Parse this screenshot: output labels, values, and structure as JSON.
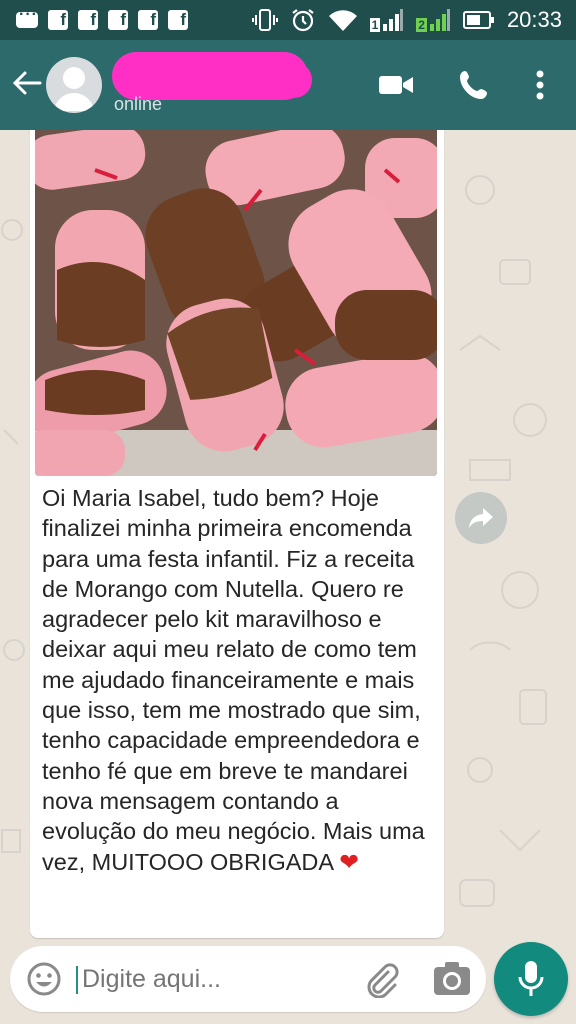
{
  "status_bar": {
    "time": "20:33",
    "sim2_label": "2",
    "sim1_label": "1",
    "icons": [
      "chat-icon",
      "facebook-icon",
      "facebook-icon",
      "facebook-icon",
      "facebook-icon",
      "facebook-icon",
      "vibrate-icon",
      "alarm-icon",
      "wifi-icon",
      "signal-icon",
      "signal-icon",
      "battery-icon"
    ]
  },
  "header": {
    "contact_status": "online",
    "icons": [
      "back-arrow-icon",
      "avatar-icon",
      "video-call-icon",
      "phone-call-icon",
      "more-vert-icon"
    ]
  },
  "message": {
    "text": "Oi Maria Isabel, tudo bem? Hoje finalizei minha primeira encomenda para uma festa infantil. Fiz a receita de Morango com Nutella. Quero re agradecer pelo kit maravilhoso e deixar aqui meu relato de como tem me ajudado financeiramente e mais que isso, tem me mostrado que sim, tenho capacidade empreendedora e tenho fé que em breve te mandarei nova mensagem contando a evolução do meu negócio. Mais uma vez, MUITOOO OBRIGADA",
    "image_description_icon": "photo-strawberry-nutella-ice-pops"
  },
  "input": {
    "placeholder": "Digite aqui..."
  },
  "colors": {
    "header": "#2d6a6b",
    "status_bar": "#1f4e4d",
    "accent": "#138a7e",
    "redaction": "#ff2fc5"
  }
}
